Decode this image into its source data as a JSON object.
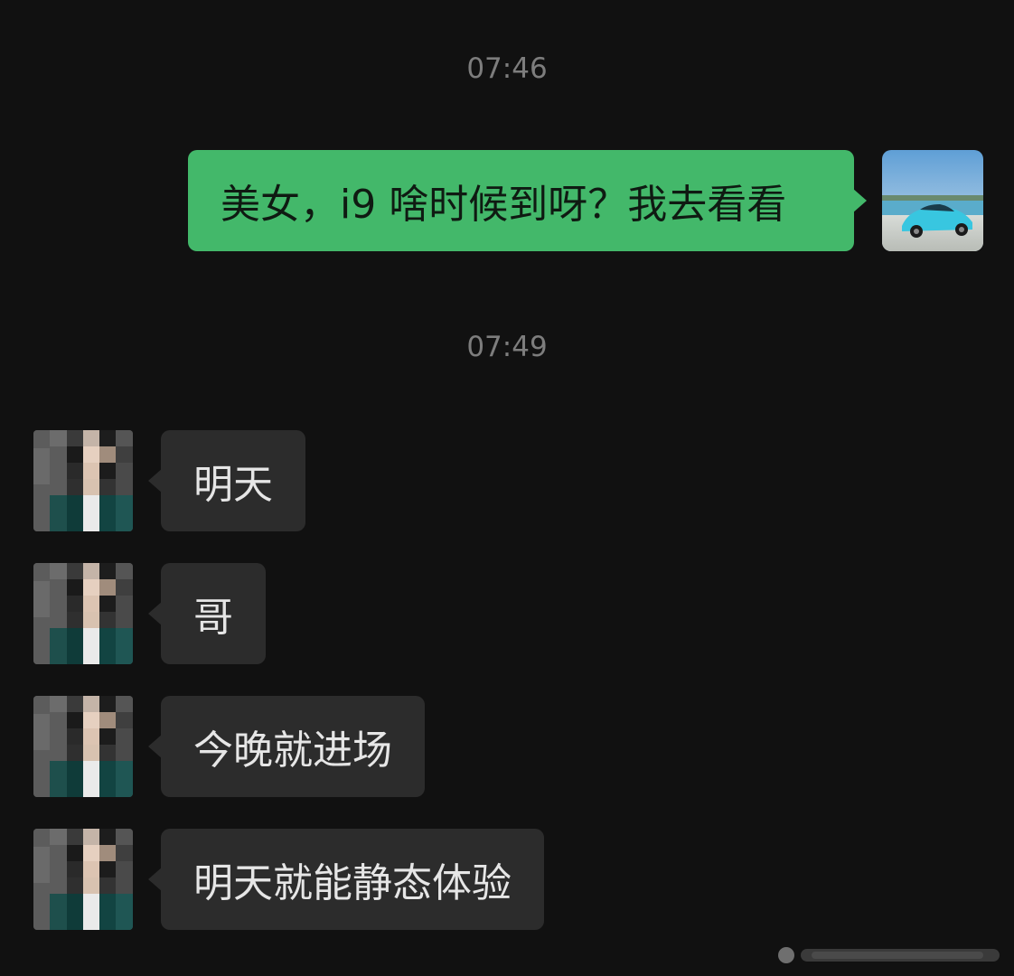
{
  "chat": {
    "timestamps": [
      "07:46",
      "07:49"
    ],
    "outgoing": [
      {
        "text": "美女，i9 啥时候到呀？我去看看"
      }
    ],
    "incoming": [
      {
        "text": "明天"
      },
      {
        "text": "哥"
      },
      {
        "text": "今晚就进场"
      },
      {
        "text": "明天就能静态体验"
      }
    ]
  },
  "icons": {
    "self_avatar": "car-photo-avatar-icon",
    "contact_avatar": "pixelated-person-avatar-icon"
  },
  "colors": {
    "background": "#111111",
    "outgoing_bubble": "#43b86a",
    "incoming_bubble": "#2c2c2c",
    "timestamp": "#7d7d7d"
  }
}
